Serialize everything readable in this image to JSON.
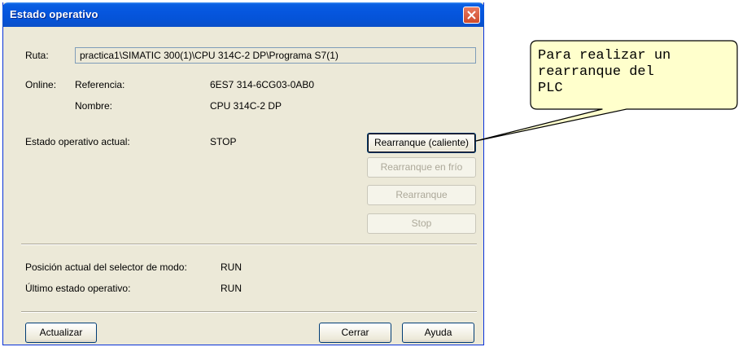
{
  "window": {
    "title": "Estado operativo",
    "close_icon": "close-icon"
  },
  "route": {
    "label": "Ruta:",
    "value": "practica1\\SIMATIC 300(1)\\CPU 314C-2 DP\\Programa S7(1)"
  },
  "online": {
    "label": "Online:",
    "reference_label": "Referencia:",
    "reference_value": "6ES7 314-6CG03-0AB0",
    "name_label": "Nombre:",
    "name_value": "CPU 314C-2 DP"
  },
  "current_state": {
    "label": "Estado operativo actual:",
    "value": "STOP"
  },
  "action_buttons": {
    "warm_restart": "Rearranque (caliente)",
    "cold_restart": "Rearranque en frío",
    "restart": "Rearranque",
    "stop": "Stop"
  },
  "mode_selector": {
    "label": "Posición actual del selector de modo:",
    "value": "RUN"
  },
  "last_state": {
    "label": "Último estado operativo:",
    "value": "RUN"
  },
  "footer_buttons": {
    "update": "Actualizar",
    "close": "Cerrar",
    "help": "Ayuda"
  },
  "callout": {
    "text": "Para realizar un\nrearranque del\nPLC",
    "background": "#ffffcc"
  }
}
